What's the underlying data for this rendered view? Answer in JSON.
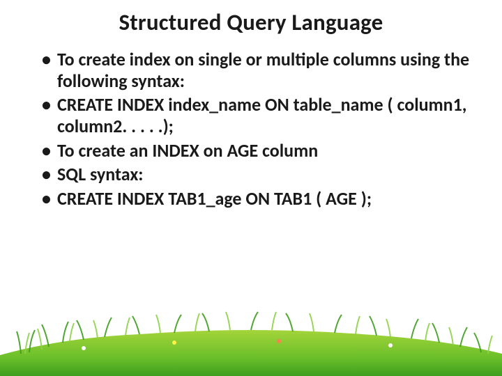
{
  "title": "Structured Query Language",
  "bullets": [
    "To create index on single or multiple columns using the following syntax:",
    "CREATE INDEX index_name ON table_name ( column1, column2. . . . .);",
    "To create an INDEX on AGE column",
    "SQL syntax:",
    "CREATE INDEX TAB1_age ON TAB1 ( AGE );"
  ]
}
